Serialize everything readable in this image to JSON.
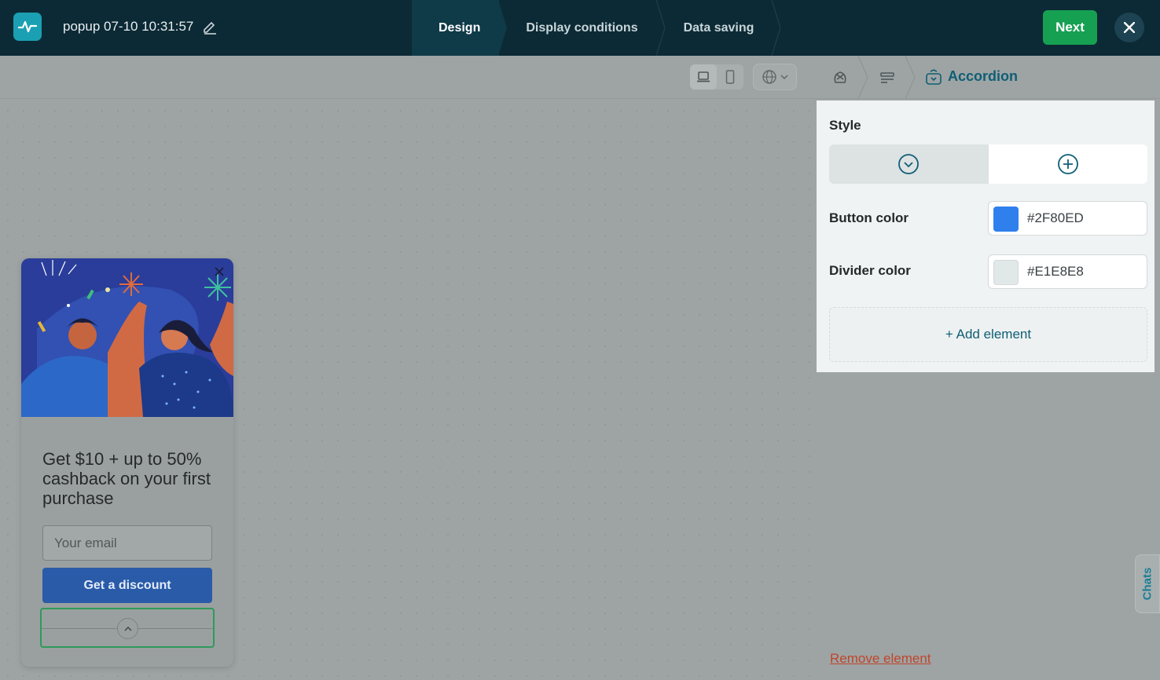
{
  "header": {
    "title": "popup 07-10 10:31:57",
    "steps": [
      {
        "label": "Design",
        "active": true
      },
      {
        "label": "Display conditions",
        "active": false
      },
      {
        "label": "Data saving",
        "active": false
      }
    ],
    "next_label": "Next"
  },
  "canvas": {
    "device_selected": "desktop"
  },
  "popup": {
    "headline": "Get $10 + up to 50% cashback on your first purchase",
    "email_placeholder": "Your email",
    "cta_label": "Get a discount"
  },
  "panel": {
    "breadcrumb_current": "Accordion",
    "style_label": "Style",
    "style_selected": "chevron",
    "button_color_label": "Button color",
    "button_color_value": "#2F80ED",
    "divider_color_label": "Divider color",
    "divider_color_value": "#E1E8E8",
    "add_element_label": "+ Add element",
    "remove_element_label": "Remove element"
  },
  "chats_label": "Chats",
  "colors": {
    "topbar": "#0c2a35",
    "next_button": "#16a052",
    "accent_teal": "#0f5e75",
    "danger": "#c0452c"
  }
}
